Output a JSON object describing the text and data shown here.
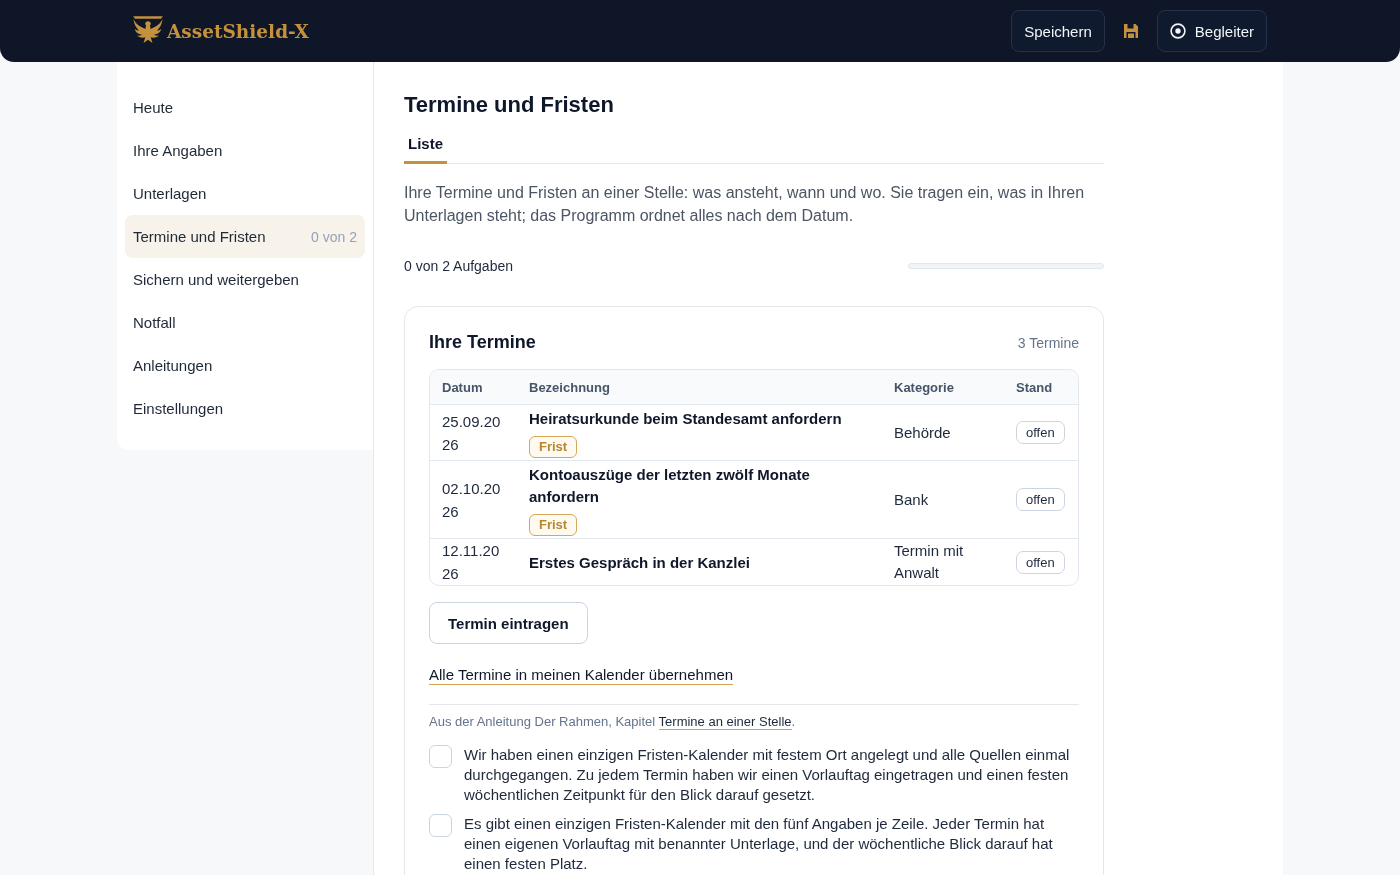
{
  "header": {
    "brand": "AssetShield-X",
    "save_button": "Speichern",
    "companion_button": "Begleiter"
  },
  "sidebar": {
    "items": [
      {
        "label": "Heute",
        "selected": false
      },
      {
        "label": "Ihre Angaben",
        "selected": false
      },
      {
        "label": "Unterlagen",
        "selected": false
      },
      {
        "label": "Termine und Fristen",
        "selected": true,
        "count": "0 von 2"
      },
      {
        "label": "Sichern und weitergeben",
        "selected": false
      },
      {
        "label": "Notfall",
        "selected": false
      },
      {
        "label": "Anleitungen",
        "selected": false
      },
      {
        "label": "Einstellungen",
        "selected": false
      }
    ]
  },
  "main": {
    "title": "Termine und Fristen",
    "tabs": [
      {
        "label": "Liste",
        "selected": true
      }
    ],
    "intro": "Ihre Termine und Fristen an einer Stelle: was ansteht, wann und wo. Sie tragen ein, was in Ihren Unterlagen steht; das Programm ordnet alles nach dem Datum.",
    "progress": {
      "label": "0 von 2 Aufgaben",
      "level": 0
    },
    "card": {
      "title": "Ihre Termine",
      "count": "3 Termine",
      "table": {
        "columns": [
          "Datum",
          "Bezeichnung",
          "Kategorie",
          "Stand"
        ],
        "rows": [
          {
            "date": "25.09.2026",
            "title": "Heiratsurkunde beim Standesamt anfordern",
            "badge": "Frist",
            "category": "Behörde",
            "status": "offen"
          },
          {
            "date": "02.10.2026",
            "title": "Kontoauszüge der letzten zwölf Monate anfordern",
            "badge": "Frist",
            "category": "Bank",
            "status": "offen"
          },
          {
            "date": "12.11.2026",
            "title": "Erstes Gespräch in der Kanzlei",
            "category": "Termin mit Anwalt",
            "status": "offen"
          }
        ]
      },
      "add_button": "Termin eintragen",
      "calendar_link": "Alle Termine in meinen Kalender übernehmen",
      "source": {
        "text": "Aus der Anleitung Der Rahmen, Kapitel",
        "link": "Termine an einer Stelle",
        "end": "."
      },
      "checklist": [
        {
          "text": "Wir haben einen einzigen Fristen-Kalender mit festem Ort angelegt und alle Quellen einmal durchgegangen. Zu jedem Termin haben wir einen Vorlauftag eingetragen und einen festen wöchentlichen Zeitpunkt für den Blick darauf gesetzt.",
          "checked": false
        },
        {
          "text": "Es gibt einen einzigen Fristen-Kalender mit den fünf Angaben je Zeile. Jeder Termin hat einen eigenen Vorlauftag mit benannter Unterlage, und der wöchentliche Blick darauf hat einen festen Platz.",
          "checked": false
        }
      ]
    }
  }
}
